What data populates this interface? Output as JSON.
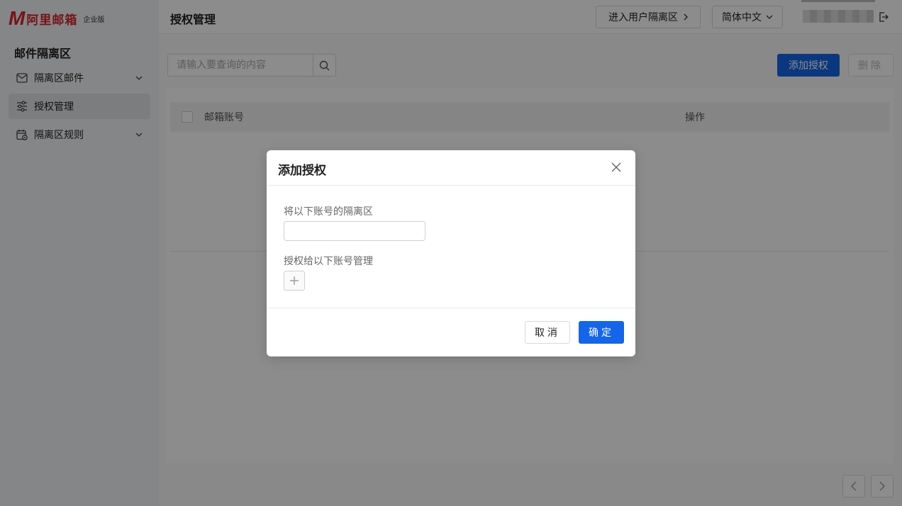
{
  "brand": {
    "mark": "M",
    "name": "阿里邮箱",
    "edition": "企业版"
  },
  "sidebar": {
    "title": "邮件隔离区",
    "items": [
      {
        "label": "隔离区邮件",
        "icon": "mail-icon",
        "has_children": true
      },
      {
        "label": "授权管理",
        "icon": "sliders-icon",
        "active": true
      },
      {
        "label": "隔离区规则",
        "icon": "calendar-gear-icon",
        "has_children": true
      }
    ]
  },
  "header": {
    "title": "授权管理",
    "enter_button": "进入用户隔离区",
    "language": "简体中文"
  },
  "toolbar": {
    "search_placeholder": "请输入要查询的内容",
    "add_label": "添加授权",
    "delete_label": "删除"
  },
  "table": {
    "columns": [
      "邮箱账号",
      "操作"
    ]
  },
  "modal": {
    "title": "添加授权",
    "field1_label": "将以下账号的隔离区",
    "field1_value": "",
    "field2_label": "授权给以下账号管理",
    "cancel_label": "取消",
    "ok_label": "确定"
  },
  "colors": {
    "primary": "#1565e8",
    "brand": "#d8262f"
  }
}
